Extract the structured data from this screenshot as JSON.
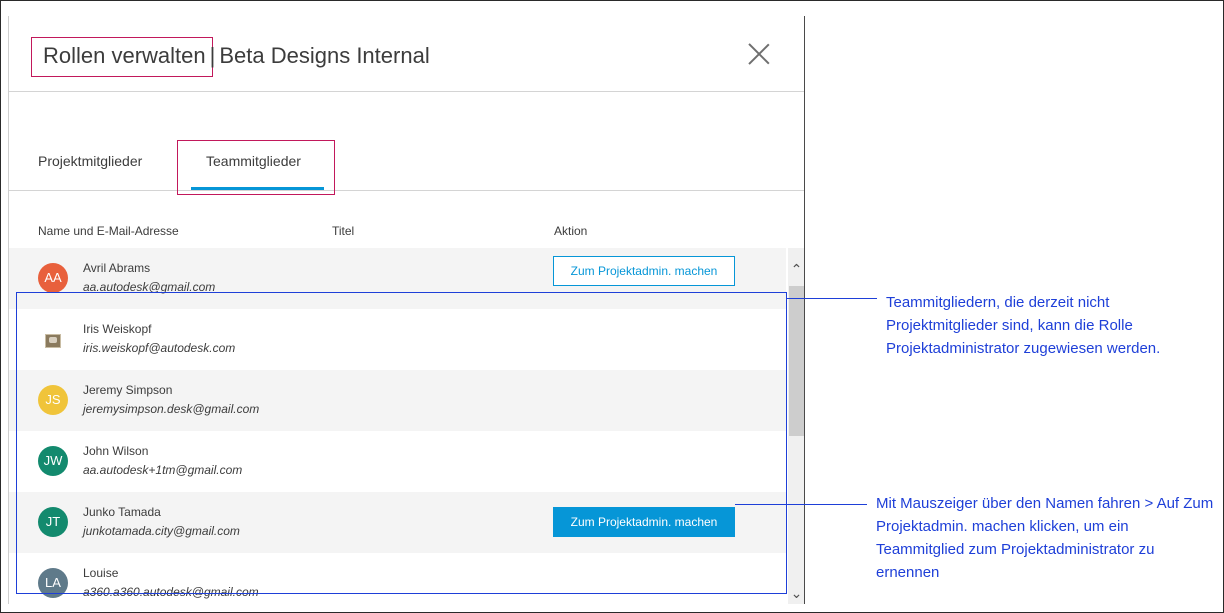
{
  "dialog": {
    "title": "Rollen verwalten",
    "separator": "|",
    "subtitle": "Beta Designs Internal",
    "close_icon": "close-icon"
  },
  "tabs": [
    {
      "label": "Projektmitglieder",
      "active": false
    },
    {
      "label": "Teammitglieder",
      "active": true
    }
  ],
  "table": {
    "headers": [
      "Name und E-Mail-Adresse",
      "Titel",
      "Aktion"
    ],
    "rows": [
      {
        "initials": "AA",
        "color": "#e8603c",
        "name": "Avril Abrams",
        "email": "aa.autodesk@gmail.com",
        "action": "Zum Projektadmin. machen",
        "action_style": "outline"
      },
      {
        "initials": "",
        "photo": true,
        "name": "Iris Weiskopf",
        "email": "iris.weiskopf@autodesk.com",
        "action": ""
      },
      {
        "initials": "JS",
        "color": "#f0c43a",
        "name": "Jeremy Simpson",
        "email": "jeremysimpson.desk@gmail.com",
        "action": ""
      },
      {
        "initials": "JW",
        "color": "#138a6e",
        "name": "John Wilson",
        "email": "aa.autodesk+1tm@gmail.com",
        "action": ""
      },
      {
        "initials": "JT",
        "color": "#138a6e",
        "name": "Junko Tamada",
        "email": "junkotamada.city@gmail.com",
        "action": "Zum Projektadmin. machen",
        "action_style": "solid"
      },
      {
        "initials": "LA",
        "color": "#5f7a8a",
        "name": "Louise",
        "email": "a360.a360.autodesk@gmail.com",
        "action": ""
      }
    ]
  },
  "scrollbar": {
    "up_icon": "chevron-up-icon",
    "down_icon": "chevron-down-icon"
  },
  "callouts": [
    "Teammitgliedern, die derzeit nicht Projektmitglieder sind, kann die Rolle Projektadministrator zugewiesen werden.",
    "Mit Mauszeiger über den Namen fahren > Auf Zum Projektadmin. machen klicken, um ein Teammitglied zum Projektadministrator zu ernennen"
  ],
  "colors": {
    "accent": "#0696d7",
    "annotation_blue": "#1e3fd8",
    "annotation_magenta": "#c2185b"
  }
}
